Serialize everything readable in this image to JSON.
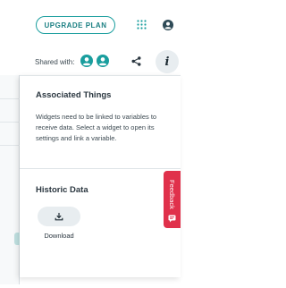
{
  "header": {
    "upgrade_label": "UPGRADE PLAN",
    "apps_icon": "grid-icon",
    "account_icon": "account-circle-icon"
  },
  "shared": {
    "label": "Shared with:",
    "avatars": [
      "user-avatar-icon",
      "user-avatar-icon"
    ],
    "share_icon": "share-icon",
    "info_icon": "info-icon",
    "info_glyph": "i"
  },
  "panel": {
    "associated_title": "Associated Things",
    "associated_body": "Widgets need to be linked to variables to receive data. Select a widget to open its settings and link a variable.",
    "historic_title": "Historic Data",
    "download_icon": "download-icon",
    "download_label": "Download"
  },
  "feedback": {
    "label": "Feedback",
    "icon": "feedback-chat-icon"
  },
  "colors": {
    "accent": "#1a9e9e",
    "feedback": "#e0314b",
    "text": "#2b3740",
    "button_bg": "#e8edf0"
  }
}
